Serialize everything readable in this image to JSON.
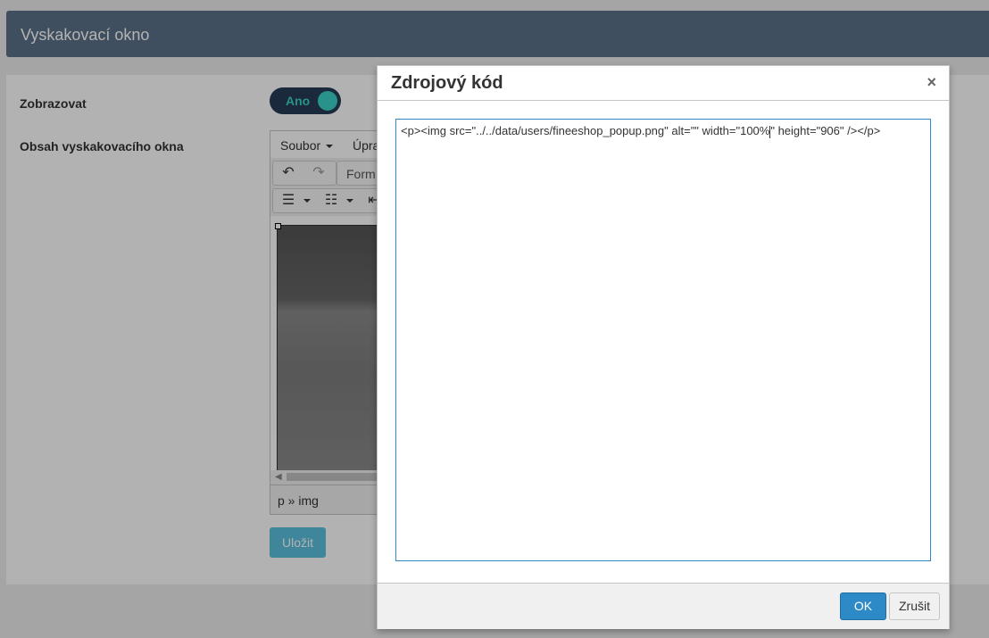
{
  "header": {
    "title": "Vyskakovací okno"
  },
  "form": {
    "show_label": "Zobrazovat",
    "toggle_value": "Ano",
    "content_label": "Obsah vyskakovacího okna",
    "save_label": "Uložit"
  },
  "editor": {
    "menu": {
      "file": "Soubor",
      "edit": "Úpra"
    },
    "toolbar": {
      "format_partial": "Form"
    },
    "statusbar_path": "p » img"
  },
  "modal": {
    "title": "Zdrojový kód",
    "close_label": "×",
    "code_before_caret": "<p><img src=\"../../data/users/fineeshop_popup.png\" alt=\"\" width=\"100%",
    "code_after_caret": "\" height=\"906\" /></p>",
    "ok_label": "OK",
    "cancel_label": "Zrušit"
  },
  "colors": {
    "header_bg": "#5c7189",
    "toggle_bg": "#263b55",
    "toggle_accent": "#3bd2c6",
    "ok_button": "#2d8ac7",
    "save_button": "#5bc0de"
  }
}
